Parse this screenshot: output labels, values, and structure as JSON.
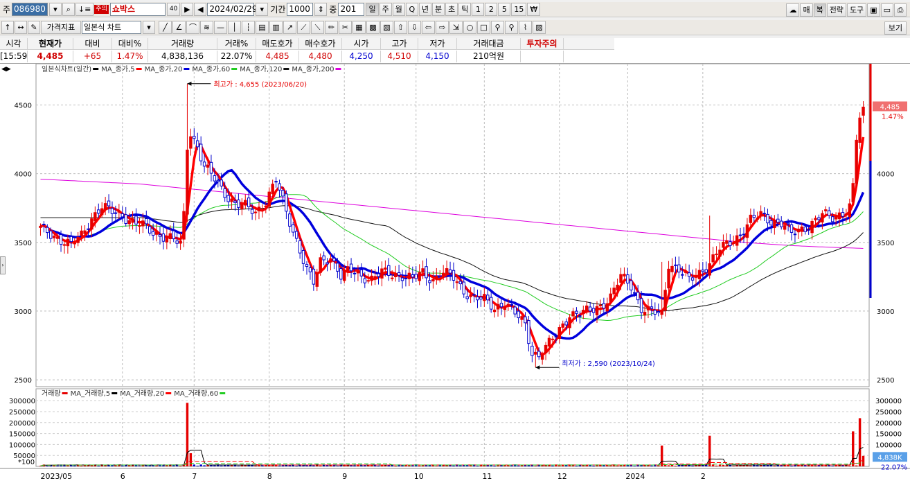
{
  "toolbar1": {
    "mode": "주",
    "code": "086980",
    "warn_badge": "주의",
    "name": "쇼박스",
    "name_tag": "40",
    "date": "2024/02/29",
    "period_label": "기간",
    "period_value": "1000",
    "mid_label": "중",
    "mid_value": "201",
    "timeframes": [
      "일",
      "주",
      "월",
      "Q",
      "년",
      "분",
      "초",
      "틱",
      "1",
      "2",
      "5",
      "15",
      "₩"
    ],
    "right_buttons": [
      "매",
      "복",
      "전략",
      "도구"
    ]
  },
  "toolbar2": {
    "price_indicator": "가격지표",
    "chart_type": "일본식 차트",
    "right_button": "보기"
  },
  "quote": {
    "headers": [
      "시각",
      "현재가",
      "대비",
      "대비%",
      "거래량",
      "거래%",
      "매도호가",
      "매수호가",
      "시가",
      "고가",
      "저가",
      "거래대금",
      "투자주의"
    ],
    "values": [
      "[15:59]",
      "4,485",
      "+65",
      "1.47%",
      "4,838,136",
      "22.07%",
      "4,485",
      "4,480",
      "4,250",
      "4,510",
      "4,150",
      "210억원",
      ""
    ]
  },
  "colors": {
    "up": "#e60000",
    "down": "#0000cc",
    "ma5": "#ff0000",
    "ma20": "#0000dd",
    "ma60": "#22cc22",
    "ma120": "#111111",
    "ma200": "#dd00dd"
  },
  "chart_data": {
    "type": "candlestick",
    "legend_price": [
      "일본식차트(일간)",
      "MA_종가,5",
      "MA_종가,20",
      "MA_종가,60",
      "MA_종가,120",
      "MA_종가,200"
    ],
    "legend_volume": [
      "거래량",
      "MA_거래량,5",
      "MA_거래량,20",
      "MA_거래량,60"
    ],
    "x_labels": [
      "2023/05",
      "6",
      "7",
      "8",
      "9",
      "10",
      "11",
      "12",
      "2024",
      "2"
    ],
    "price_ticks": [
      2500,
      3000,
      3500,
      4000,
      4500
    ],
    "price_ylim": [
      2450,
      4800
    ],
    "volume_ticks": [
      50000,
      100000,
      150000,
      200000,
      250000,
      300000
    ],
    "volume_unit": "*100",
    "volume_ylim": [
      0,
      310000
    ],
    "high_marker": {
      "label": "최고가 : 4,655 (2023/06/20)",
      "value": 4655
    },
    "low_marker": {
      "label": "최저가 : 2,590 (2023/10/24)",
      "value": 2590
    },
    "current_price": "4,485",
    "current_pct": "1.47%",
    "current_volume": "4,838K",
    "current_volume_pct": "22.07%",
    "price_anchors": [
      [
        0,
        3600
      ],
      [
        3,
        3560
      ],
      [
        6,
        3520
      ],
      [
        9,
        3480
      ],
      [
        12,
        3550
      ],
      [
        15,
        3680
      ],
      [
        18,
        3760
      ],
      [
        21,
        3720
      ],
      [
        24,
        3700
      ],
      [
        27,
        3650
      ],
      [
        30,
        3620
      ],
      [
        33,
        3570
      ],
      [
        36,
        3550
      ],
      [
        39,
        3520
      ],
      [
        41,
        3480
      ],
      [
        42,
        3700
      ],
      [
        43,
        4200
      ],
      [
        44,
        4300
      ],
      [
        46,
        4200
      ],
      [
        48,
        4050
      ],
      [
        51,
        3960
      ],
      [
        54,
        3860
      ],
      [
        57,
        3780
      ],
      [
        60,
        3760
      ],
      [
        63,
        3720
      ],
      [
        66,
        3800
      ],
      [
        69,
        3950
      ],
      [
        72,
        3720
      ],
      [
        75,
        3520
      ],
      [
        78,
        3300
      ],
      [
        80,
        3200
      ],
      [
        82,
        3360
      ],
      [
        85,
        3400
      ],
      [
        88,
        3250
      ],
      [
        91,
        3300
      ],
      [
        94,
        3260
      ],
      [
        97,
        3230
      ],
      [
        100,
        3280
      ],
      [
        103,
        3270
      ],
      [
        106,
        3260
      ],
      [
        109,
        3230
      ],
      [
        112,
        3280
      ],
      [
        115,
        3230
      ],
      [
        118,
        3280
      ],
      [
        121,
        3240
      ],
      [
        124,
        3150
      ],
      [
        127,
        3100
      ],
      [
        130,
        3080
      ],
      [
        133,
        3020
      ],
      [
        136,
        3070
      ],
      [
        139,
        2980
      ],
      [
        142,
        2900
      ],
      [
        144,
        2700
      ],
      [
        146,
        2680
      ],
      [
        149,
        2760
      ],
      [
        152,
        2860
      ],
      [
        155,
        2980
      ],
      [
        158,
        2980
      ],
      [
        161,
        3000
      ],
      [
        164,
        3040
      ],
      [
        167,
        3100
      ],
      [
        170,
        3250
      ],
      [
        173,
        3190
      ],
      [
        176,
        3020
      ],
      [
        179,
        2990
      ],
      [
        182,
        2980
      ],
      [
        184,
        3350
      ],
      [
        187,
        3300
      ],
      [
        190,
        3220
      ],
      [
        193,
        3280
      ],
      [
        196,
        3350
      ],
      [
        199,
        3450
      ],
      [
        202,
        3500
      ],
      [
        205,
        3560
      ],
      [
        208,
        3660
      ],
      [
        211,
        3700
      ],
      [
        214,
        3660
      ],
      [
        217,
        3640
      ],
      [
        220,
        3560
      ],
      [
        223,
        3600
      ],
      [
        226,
        3640
      ],
      [
        229,
        3700
      ],
      [
        232,
        3680
      ],
      [
        235,
        3720
      ],
      [
        237,
        3760
      ],
      [
        238,
        3900
      ],
      [
        239,
        4250
      ],
      [
        240,
        4400
      ],
      [
        241,
        4485
      ]
    ],
    "volume_spikes": [
      [
        43,
        290000
      ],
      [
        44,
        60000
      ],
      [
        182,
        95000
      ],
      [
        196,
        140000
      ],
      [
        238,
        160000
      ],
      [
        240,
        220000
      ],
      [
        241,
        48000
      ]
    ],
    "n_candles": 242
  }
}
